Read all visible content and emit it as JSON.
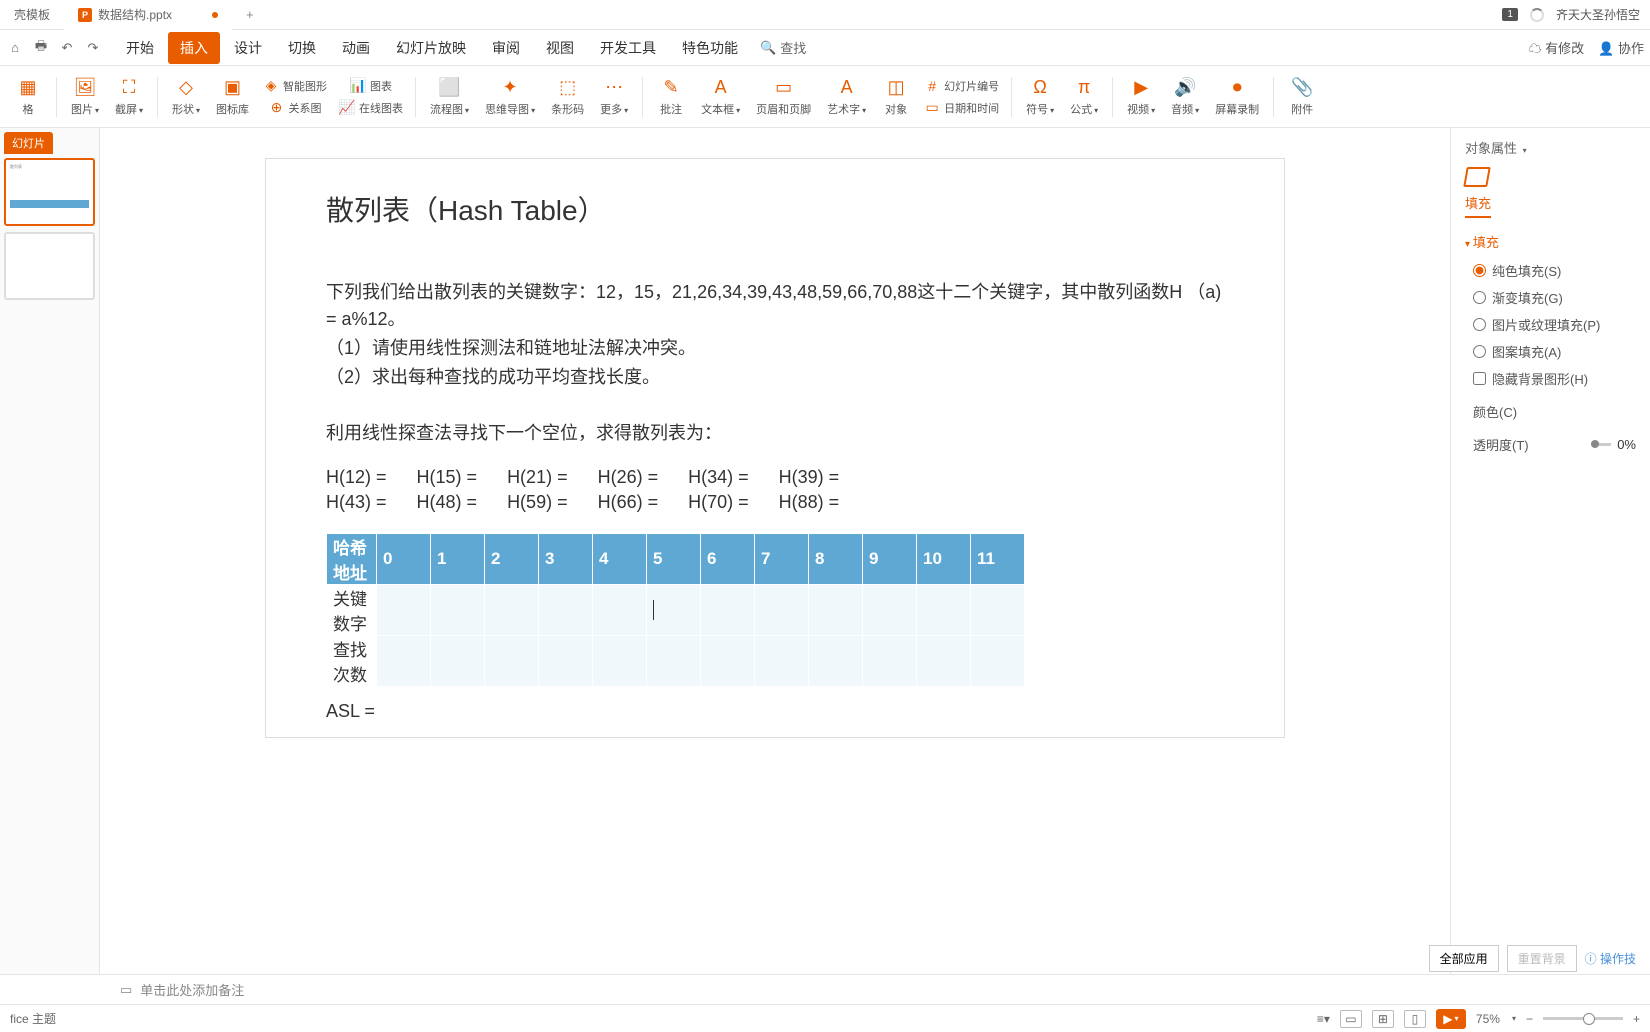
{
  "tabs": {
    "tab1": "壳模板",
    "tab2": "数据结构.pptx"
  },
  "user": {
    "name": "齐天大圣孙悟空",
    "badge": "1"
  },
  "menu": {
    "start": "开始",
    "insert": "插入",
    "design": "设计",
    "transition": "切换",
    "animation": "动画",
    "slideshow": "幻灯片放映",
    "review": "审阅",
    "view": "视图",
    "devtools": "开发工具",
    "special": "特色功能",
    "search": "查找",
    "hasChanges": "有修改",
    "collab": "协作"
  },
  "ribbon": {
    "table": "格",
    "image": "图片",
    "screenshot": "截屏",
    "shape": "形状",
    "gallery": "图标库",
    "smartart": "智能图形",
    "relation": "关系图",
    "chart": "图表",
    "onlinechart": "在线图表",
    "flowchart": "流程图",
    "mindmap": "思维导图",
    "barcode": "条形码",
    "more": "更多",
    "comment": "批注",
    "textbox": "文本框",
    "headerfooter": "页眉和页脚",
    "wordart": "艺术字",
    "object": "对象",
    "slidenum": "幻灯片编号",
    "datetime": "日期和时间",
    "symbol": "符号",
    "formula": "公式",
    "video": "视频",
    "audio": "音频",
    "screenrec": "屏幕录制",
    "attach": "附件"
  },
  "slidepanel": {
    "tab": "幻灯片"
  },
  "slide": {
    "title": "散列表（Hash Table）",
    "body1": "下列我们给出散列表的关键数字：12，15，21,26,34,39,43,48,59,66,70,88这十二个关键字，其中散列函数H （a) = a%12。",
    "body2": "（1）请使用线性探测法和链地址法解决冲突。",
    "body3": "（2）求出每种查找的成功平均查找长度。",
    "body4": "利用线性探查法寻找下一个空位，求得散列表为：",
    "formulas": {
      "row1": [
        "H(12) =",
        "H(15) =",
        "H(21) =",
        "H(26) =",
        "H(34) =",
        "H(39) ="
      ],
      "row2": [
        "H(43) =",
        "H(48) =",
        "H(59) =",
        "H(66) =",
        "H(70) =",
        "H(88) ="
      ]
    },
    "table": {
      "header": "哈希地址",
      "cols": [
        "0",
        "1",
        "2",
        "3",
        "4",
        "5",
        "6",
        "7",
        "8",
        "9",
        "10",
        "11"
      ],
      "row1": "关键数字",
      "row2": "查找次数"
    },
    "asl": "ASL ="
  },
  "rightpanel": {
    "title": "对象属性",
    "tab": "填充",
    "section": "填充",
    "solid": "纯色填充(S)",
    "gradient": "渐变填充(G)",
    "picture": "图片或纹理填充(P)",
    "pattern": "图案填充(A)",
    "hidebg": "隐藏背景图形(H)",
    "color": "颜色(C)",
    "opacity": "透明度(T)",
    "opacityval": "0%",
    "applyall": "全部应用",
    "reset": "重置背景",
    "tips": "操作技"
  },
  "notes": {
    "placeholder": "单击此处添加备注"
  },
  "status": {
    "theme": "fice 主题",
    "zoom": "75%"
  }
}
